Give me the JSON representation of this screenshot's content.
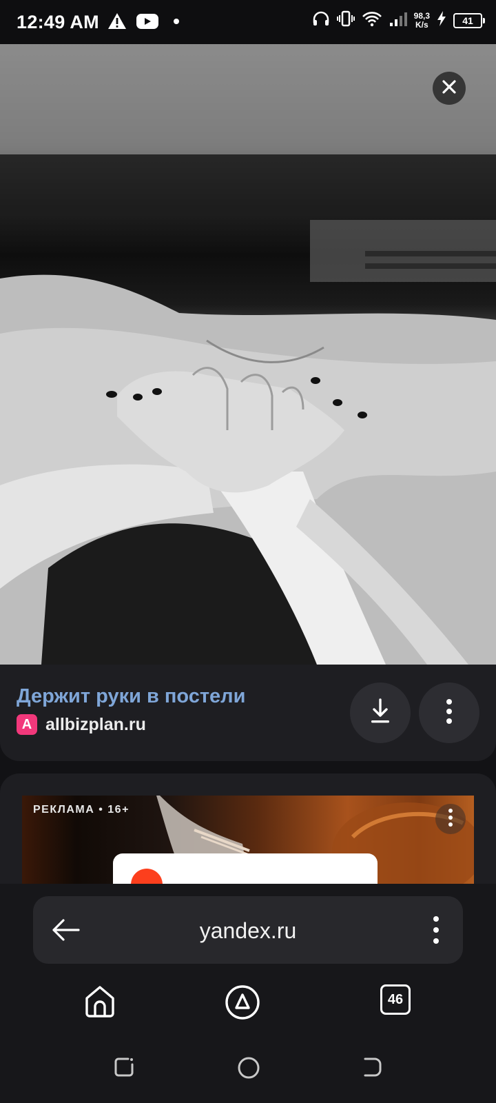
{
  "status_bar": {
    "time": "12:49 AM",
    "network_speed_value": "98,3",
    "network_speed_unit": "K/s",
    "battery_level": "41",
    "icons": [
      "warning-icon",
      "youtube-icon",
      "dot-icon",
      "headphones-icon",
      "vibrate-icon",
      "wifi-icon",
      "signal-icon",
      "charging-icon",
      "battery-icon"
    ]
  },
  "image_viewer": {
    "close_icon": "close-icon"
  },
  "result": {
    "title": "Держит руки в постели",
    "source_logo_letter": "A",
    "source_domain": "allbizplan.ru",
    "download_icon": "download-icon",
    "more_icon": "more-vertical-icon"
  },
  "ad": {
    "label": "РЕКЛАМА • 16+",
    "more_icon": "more-vertical-icon"
  },
  "browser": {
    "url": "yandex.ru",
    "back_icon": "arrow-left-icon",
    "menu_icon": "more-vertical-icon",
    "tab_count": "46",
    "home_icon": "home-icon",
    "alice_icon": "alice-icon"
  },
  "colors": {
    "title": "#7fa6d8",
    "source_logo": "#f2387b",
    "card_bg": "#1e1e22",
    "page_bg": "#121215"
  }
}
